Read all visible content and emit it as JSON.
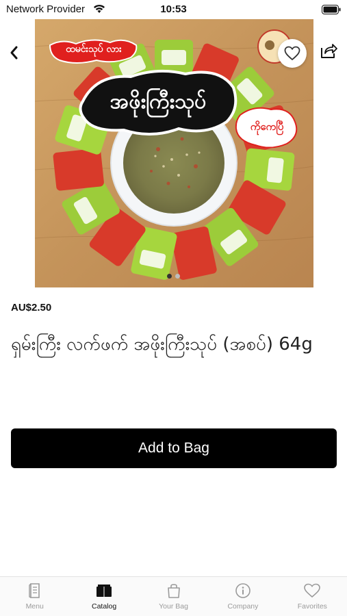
{
  "status_bar": {
    "carrier": "Network Provider",
    "time": "10:53"
  },
  "product": {
    "image_texts": {
      "banner_top": "ထမင်းသုပ် လား",
      "banner_main": "အဖိုးကြီးသုပ်",
      "badge": "ကိုကေပြီ"
    },
    "image_pager": {
      "count": 2,
      "active_index": 0
    },
    "price": "AU$2.50",
    "title": "ရှမ်းကြီး လက်ဖက် အဖိုးကြီးသုပ် (အစပ်) 64g",
    "add_button_label": "Add to Bag"
  },
  "tabs": [
    {
      "label": "Menu",
      "icon": "menu-book-icon",
      "active": false
    },
    {
      "label": "Catalog",
      "icon": "catalog-box-icon",
      "active": true
    },
    {
      "label": "Your Bag",
      "icon": "shopping-bag-icon",
      "active": false
    },
    {
      "label": "Company",
      "icon": "info-icon",
      "active": false
    },
    {
      "label": "Favorites",
      "icon": "heart-icon",
      "active": false
    }
  ],
  "colors": {
    "primary_button": "#000000",
    "active_tab": "#111111",
    "inactive_tab": "#9a9a9a"
  }
}
